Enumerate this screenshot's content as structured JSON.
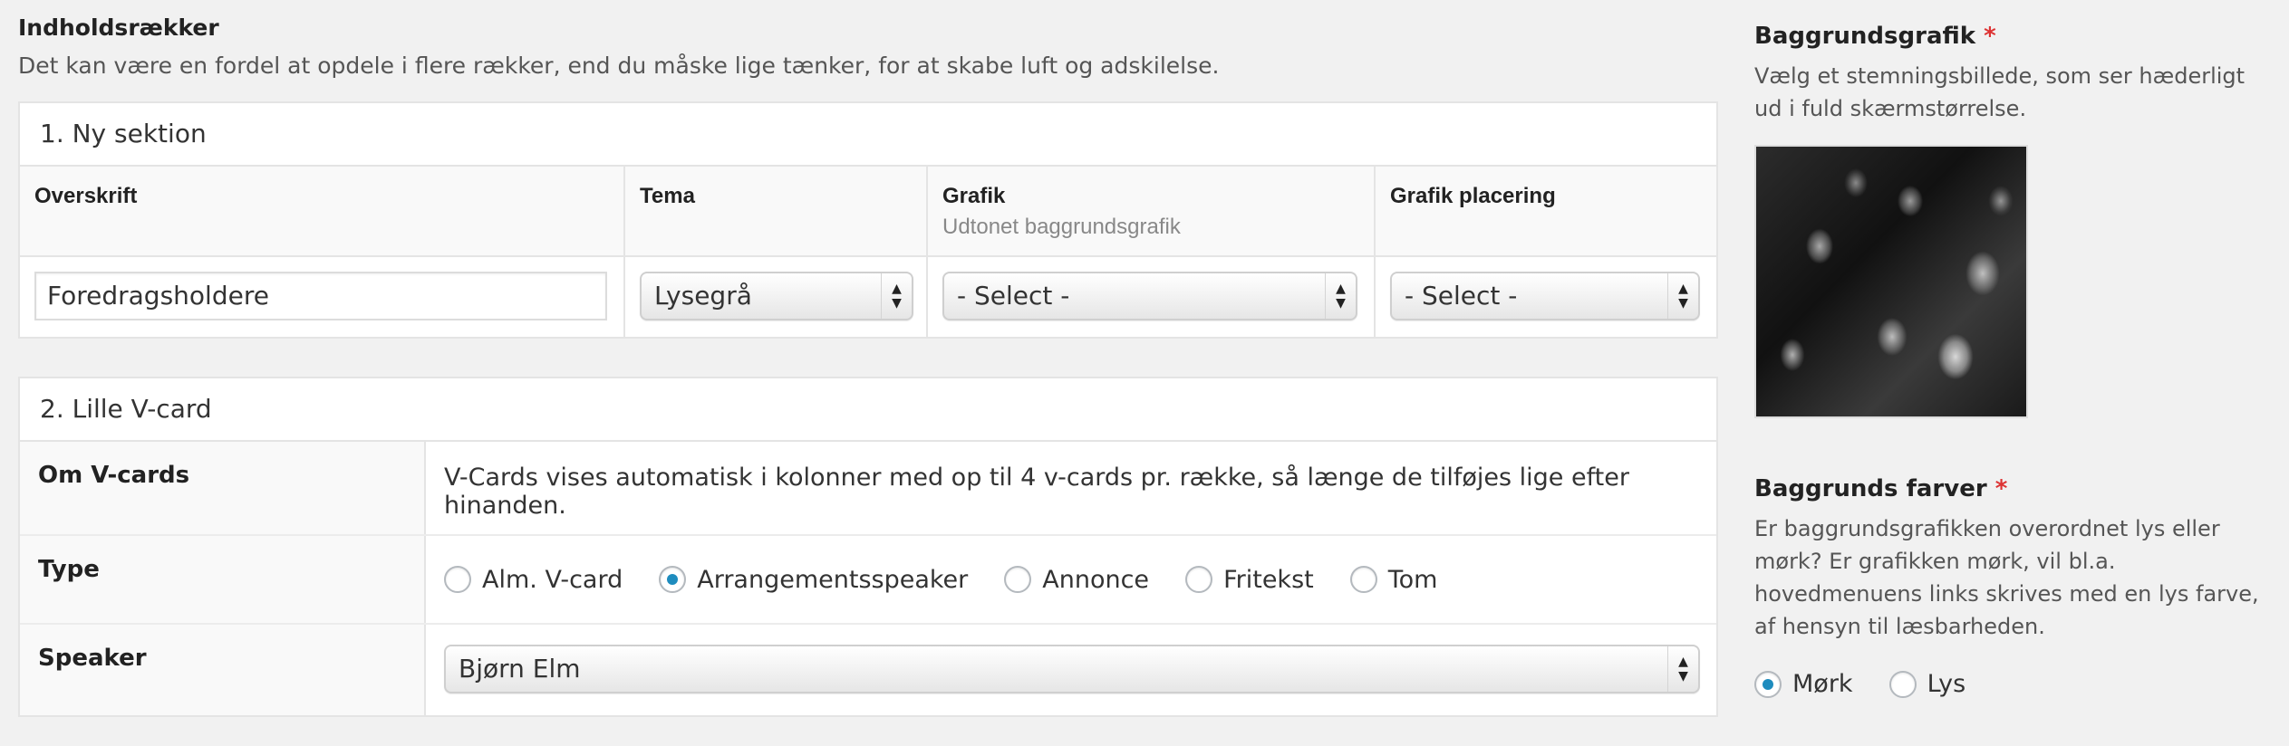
{
  "main": {
    "title": "Indholdsrækker",
    "description": "Det kan være en fordel at opdele i flere rækker, end du måske lige tænker, for at skabe luft og adskilelse.",
    "section1": {
      "heading": "1. Ny sektion",
      "headers": {
        "overskrift": "Overskrift",
        "tema": "Tema",
        "grafik": "Grafik",
        "grafik_sub": "Udtonet baggrundsgrafik",
        "grafik_placering": "Grafik placering"
      },
      "values": {
        "overskrift": "Foredragsholdere",
        "tema": "Lysegrå",
        "grafik": "- Select -",
        "grafik_placering": "- Select -"
      }
    },
    "section2": {
      "heading": "2. Lille V-card",
      "om_label": "Om V-cards",
      "om_text": "V-Cards vises automatisk i kolonner med op til 4 v-cards pr. række, så længe de tilføjes lige efter hinanden.",
      "type_label": "Type",
      "type_options": [
        "Alm. V-card",
        "Arrangementsspeaker",
        "Annonce",
        "Fritekst",
        "Tom"
      ],
      "type_selected": "Arrangementsspeaker",
      "speaker_label": "Speaker",
      "speaker_value": "Bjørn Elm"
    }
  },
  "sidebar": {
    "bg_image": {
      "title": "Baggrundsgrafik",
      "required": "*",
      "description": "Vælg et stemningsbillede, som ser hæderligt ud i fuld skærmstørrelse."
    },
    "bg_color": {
      "title": "Baggrunds farver",
      "required": "*",
      "description": "Er baggrundsgrafikken overordnet lys eller mørk? Er grafikken mørk, vil bl.a. hovedmenuens links skrives med en lys farve, af hensyn til læsbarheden.",
      "options": [
        "Mørk",
        "Lys"
      ],
      "selected": "Mørk"
    }
  },
  "icons": {
    "select_arrows": "▲▼"
  },
  "colors": {
    "accent": "#1e8cbe",
    "required": "#dd3333"
  }
}
